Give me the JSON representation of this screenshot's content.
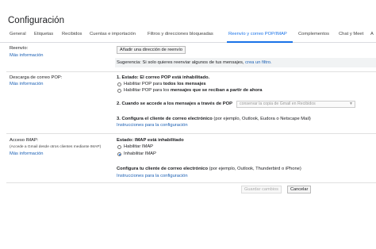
{
  "page_title": "Configuración",
  "tabs": [
    "General",
    "Etiquetas",
    "Recibidos",
    "Cuentas e importación",
    "Filtros y direcciones bloqueadas",
    "Reenvío y correo POP/IMAP",
    "Complementos",
    "Chat y Meet",
    "A"
  ],
  "active_tab": "Reenvío y correo POP/IMAP",
  "forwarding": {
    "label": "Reenvío:",
    "more_info": "Más información",
    "add_button": "Añadir una dirección de reenvío",
    "hint_text": "Sugerencia: Si solo quieres reenviar algunos de tus mensajes,",
    "hint_link": "crea un filtro."
  },
  "pop": {
    "label": "Descarga de correo POP:",
    "more_info": "Más información",
    "status": "1. Estado: El correo POP está inhabilitado.",
    "option_all_prefix": "Habilitar POP para ",
    "option_all_bold": "todos los mensajes",
    "option_new_prefix": "Habilitar POP para los ",
    "option_new_bold": "mensajes que se reciban a partir de ahora",
    "step2": "2. Cuando se accede a los mensajes a través de POP",
    "step2_select": "conservar la copia de Gmail en Recibidos",
    "step3_bold": "3. Configura el cliente de correo electrónico",
    "step3_rest": " (por ejemplo, Outlook, Eudora o Netscape Mail)",
    "step3_link": "Instrucciones para la configuración"
  },
  "imap": {
    "label": "Acceso IMAP:",
    "sublabel": "(Accede a Gmail desde otros clientes mediante IMAP)",
    "more_info": "Más información",
    "status": "Estado: IMAP está inhabilitado",
    "option_enable": "Habilitar IMAP",
    "option_disable": "Inhabilitar IMAP",
    "configure_bold": "Configura tu cliente de correo electrónico",
    "configure_rest": " (por ejemplo, Outlook, Thunderbird o iPhone)",
    "configure_link": "Instrucciones para la configuración",
    "selected": "Inhabilitar IMAP"
  },
  "footer": {
    "save": "Guardar cambios",
    "cancel": "Cancelar"
  },
  "colors": {
    "link": "#1a5fb4",
    "accent": "#1a73e8"
  }
}
